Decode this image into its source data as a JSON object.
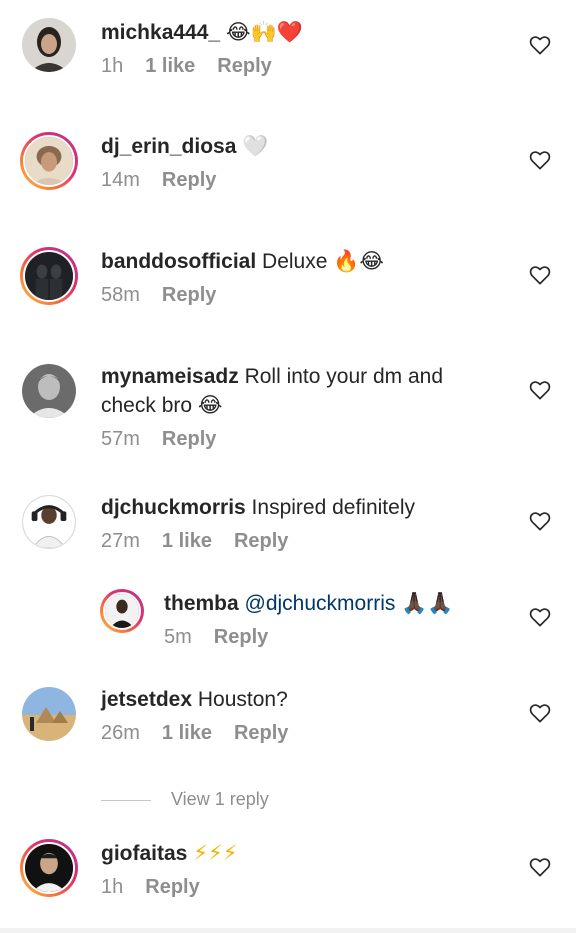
{
  "comments": [
    {
      "username": "michka444_",
      "text": " ",
      "emoji": "😂🙌❤️",
      "time": "1h",
      "likes": "1 like",
      "reply": "Reply"
    },
    {
      "username": "dj_erin_diosa",
      "text": " ",
      "emoji": "🤍",
      "time": "14m",
      "likes": "",
      "reply": "Reply"
    },
    {
      "username": "banddosofficial",
      "text": " Deluxe ",
      "emoji": "🔥😂",
      "time": "58m",
      "likes": "",
      "reply": "Reply"
    },
    {
      "username": "mynameisadz",
      "text": " Roll into your dm and check bro ",
      "emoji": "😂",
      "time": "57m",
      "likes": "",
      "reply": "Reply"
    },
    {
      "username": "djchuckmorris",
      "text": " Inspired definitely",
      "emoji": "",
      "time": "27m",
      "likes": "1 like",
      "reply": "Reply"
    },
    {
      "username": "themba",
      "mention": " @djchuckmorris ",
      "text": "",
      "emoji": "🙏🏿🙏🏿",
      "time": "5m",
      "likes": "",
      "reply": "Reply"
    },
    {
      "username": "jetsetdex",
      "text": " Houston?",
      "emoji": "",
      "time": "26m",
      "likes": "1 like",
      "reply": "Reply"
    },
    {
      "username": "giofaitas",
      "text": " ",
      "emoji": "⚡⚡⚡",
      "time": "1h",
      "likes": "",
      "reply": "Reply"
    }
  ],
  "view_replies": "View 1 reply",
  "icons": {
    "like": "heart-outline-icon"
  },
  "colors": {
    "text": "#262626",
    "secondary": "#8e8e8e",
    "mention": "#00376b"
  }
}
